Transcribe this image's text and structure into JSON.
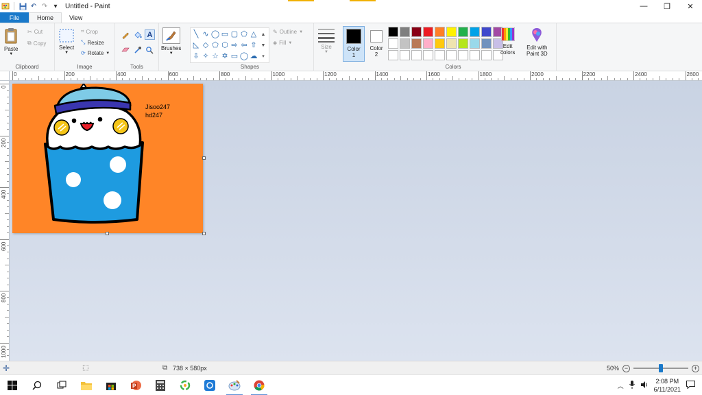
{
  "window": {
    "title": "Untitled - Paint",
    "controls": {
      "minimize": "—",
      "restore": "❐",
      "close": "✕"
    }
  },
  "quick_access": {
    "undo": "↶",
    "redo": "↷",
    "dropdown": "▾"
  },
  "tabs": [
    {
      "label": "File"
    },
    {
      "label": "Home"
    },
    {
      "label": "View"
    }
  ],
  "ribbon": {
    "clipboard": {
      "label": "Clipboard",
      "paste": "Paste",
      "cut": "Cut",
      "copy": "Copy"
    },
    "image": {
      "label": "Image",
      "select": "Select",
      "crop": "Crop",
      "resize": "Resize",
      "rotate": "Rotate"
    },
    "tools": {
      "label": "Tools"
    },
    "brushes": {
      "label": "Brushes"
    },
    "shapes": {
      "label": "Shapes",
      "outline": "Outline",
      "fill": "Fill"
    },
    "size": {
      "label": "Size"
    },
    "color1": {
      "label": "Color",
      "number": "1",
      "color": "#000000"
    },
    "color2": {
      "label": "Color",
      "number": "2",
      "color": "#ffffff"
    },
    "colors": {
      "label": "Colors",
      "palette_row1": [
        "#000000",
        "#7f7f7f",
        "#880015",
        "#ed1c24",
        "#ff7f27",
        "#fff200",
        "#22b14c",
        "#00a2e8",
        "#3f48cc",
        "#a349a4"
      ],
      "palette_row2": [
        "#ffffff",
        "#c3c3c3",
        "#b97a57",
        "#ffaec9",
        "#ffc90e",
        "#efe4b0",
        "#b5e61d",
        "#99d9ea",
        "#7092be",
        "#c8bfe7"
      ],
      "palette_row3": [
        "#ffffff",
        "#ffffff",
        "#ffffff",
        "#ffffff",
        "#ffffff",
        "#ffffff",
        "#ffffff",
        "#ffffff",
        "#ffffff",
        "#ffffff"
      ]
    },
    "edit_colors": {
      "line1": "Edit",
      "line2": "colors"
    },
    "paint3d": {
      "line1": "Edit with",
      "line2": "Paint 3D"
    }
  },
  "ruler": {
    "horizontal": [
      "0",
      "200",
      "400",
      "600",
      "800",
      "1000",
      "1200",
      "1400",
      "1600",
      "1800",
      "2000",
      "2200",
      "2400",
      "2600"
    ],
    "vertical": [
      "0",
      "200",
      "400",
      "600",
      "800",
      "1000"
    ]
  },
  "canvas": {
    "background": "#ff8527",
    "text_line1": "Jisoo247",
    "text_line2": "hd247"
  },
  "status": {
    "dimensions": "738 × 580px",
    "zoom": "50%",
    "zoom_level": 0.5
  },
  "taskbar": {
    "time": "2:08 PM",
    "date": "6/11/2021"
  }
}
